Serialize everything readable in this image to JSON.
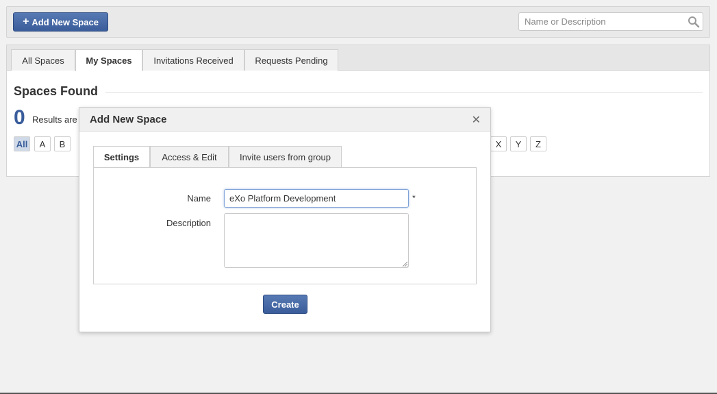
{
  "toolbar": {
    "add_button_icon": "plus-icon",
    "add_button_label": "Add New Space",
    "search_placeholder": "Name or Description",
    "search_icon": "search-icon"
  },
  "tabs": [
    {
      "label": "All Spaces",
      "active": false
    },
    {
      "label": "My Spaces",
      "active": true
    },
    {
      "label": "Invitations Received",
      "active": false
    },
    {
      "label": "Requests Pending",
      "active": false
    }
  ],
  "results": {
    "title": "Spaces Found",
    "count": "0",
    "text": "Results are"
  },
  "letters_left": [
    "All",
    "A",
    "B"
  ],
  "letters_right": [
    "X",
    "Y",
    "Z"
  ],
  "modal": {
    "title": "Add New Space",
    "close_icon": "close-icon",
    "tabs": [
      {
        "label": "Settings",
        "active": true
      },
      {
        "label": "Access & Edit",
        "active": false
      },
      {
        "label": "Invite users from group",
        "active": false
      }
    ],
    "name_label": "Name",
    "name_value": "eXo Platform Development",
    "required_mark": "*",
    "description_label": "Description",
    "description_value": "",
    "create_label": "Create"
  },
  "colors": {
    "primary_button": "#3a5d9b",
    "active_letter_bg": "#cfd9e8"
  }
}
